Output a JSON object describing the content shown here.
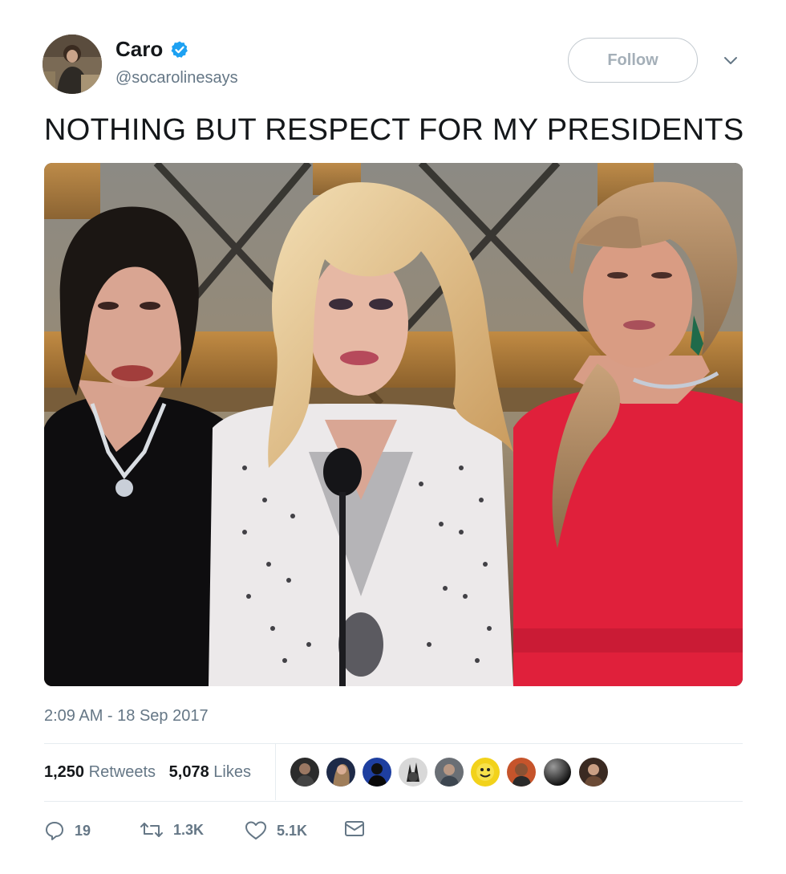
{
  "user": {
    "name": "Caro",
    "handle": "@socarolinesays",
    "verified": true
  },
  "header": {
    "follow_label": "Follow"
  },
  "tweet": {
    "text": "NOTHING BUT RESPECT FOR MY PRESIDENTS",
    "timestamp": "2:09 AM - 18 Sep 2017"
  },
  "stats": {
    "retweets_count": "1,250",
    "retweets_label": "Retweets",
    "likes_count": "5,078",
    "likes_label": "Likes"
  },
  "actions": {
    "reply_count": "19",
    "retweet_count": "1.3K",
    "like_count": "5.1K"
  },
  "icons": {
    "verified": "verified-badge-icon",
    "caret": "chevron-down-icon",
    "reply": "reply-icon",
    "retweet": "retweet-icon",
    "like": "heart-icon",
    "dm": "envelope-icon"
  },
  "colors": {
    "verified_blue": "#1da1f2",
    "secondary_text": "#657786",
    "primary_text": "#14171a",
    "divider": "#e6ecf0"
  }
}
